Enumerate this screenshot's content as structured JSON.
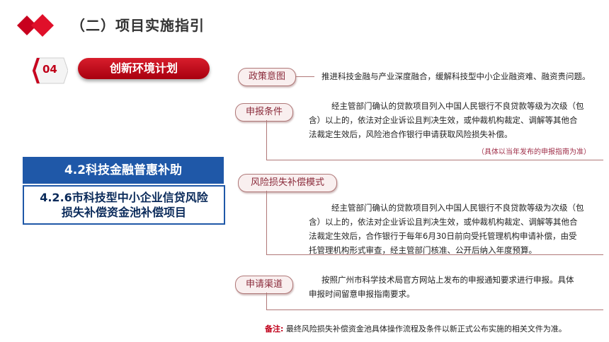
{
  "header": {
    "title": "（二）项目实施指引"
  },
  "section": {
    "number": "04",
    "label": "创新环境计划"
  },
  "left_panel": {
    "subtitle": "4.2科技金融普惠补助",
    "project": "4.2.6市科技型中小企业信贷风险损失补偿资金池补偿项目"
  },
  "document": {
    "policy": {
      "tag": "政策意图",
      "text": "推进科技金融与产业深度融合，缓解科技型中小企业融资难、融资贵问题。"
    },
    "apply": {
      "tag": "申报条件",
      "lines": [
        "经主管部门确认的贷款项目列入中国人民银行不良贷款等级为次级（包",
        "含）以上的，依法对企业诉讼且判决生效，或仲裁机构裁定、调解等其他合",
        "法裁定生效后，风险池合作银行申请获取风险损失补偿。"
      ],
      "note": "（具体以当年发布的申报指南为准）"
    },
    "mode": {
      "tag": "风险损失补偿模式",
      "lines": [
        "经主管部门确认的贷款项目列入中国人民银行不良贷款等级为次级（包",
        "含）以上的，依法对企业诉讼且判决生效，或仲裁机构裁定、调解等其他合",
        "法裁定生效后，合作银行于每年6月30日前向受托管理机构申请补偿，由受",
        "托管理机构形式审查，经主管部门核准、公开后纳入年度预算。"
      ]
    },
    "channel": {
      "tag": "申请渠道",
      "lines": [
        "按照广州市科学技术局官方网站上发布的申报通知要求进行申报。具体",
        "申报时间留意申报指南要求。"
      ]
    },
    "remark": {
      "label": "备注:",
      "text": "最终风险损失补偿资金池具体操作流程及条件以新正式公布实施的相关文件为准。"
    }
  }
}
